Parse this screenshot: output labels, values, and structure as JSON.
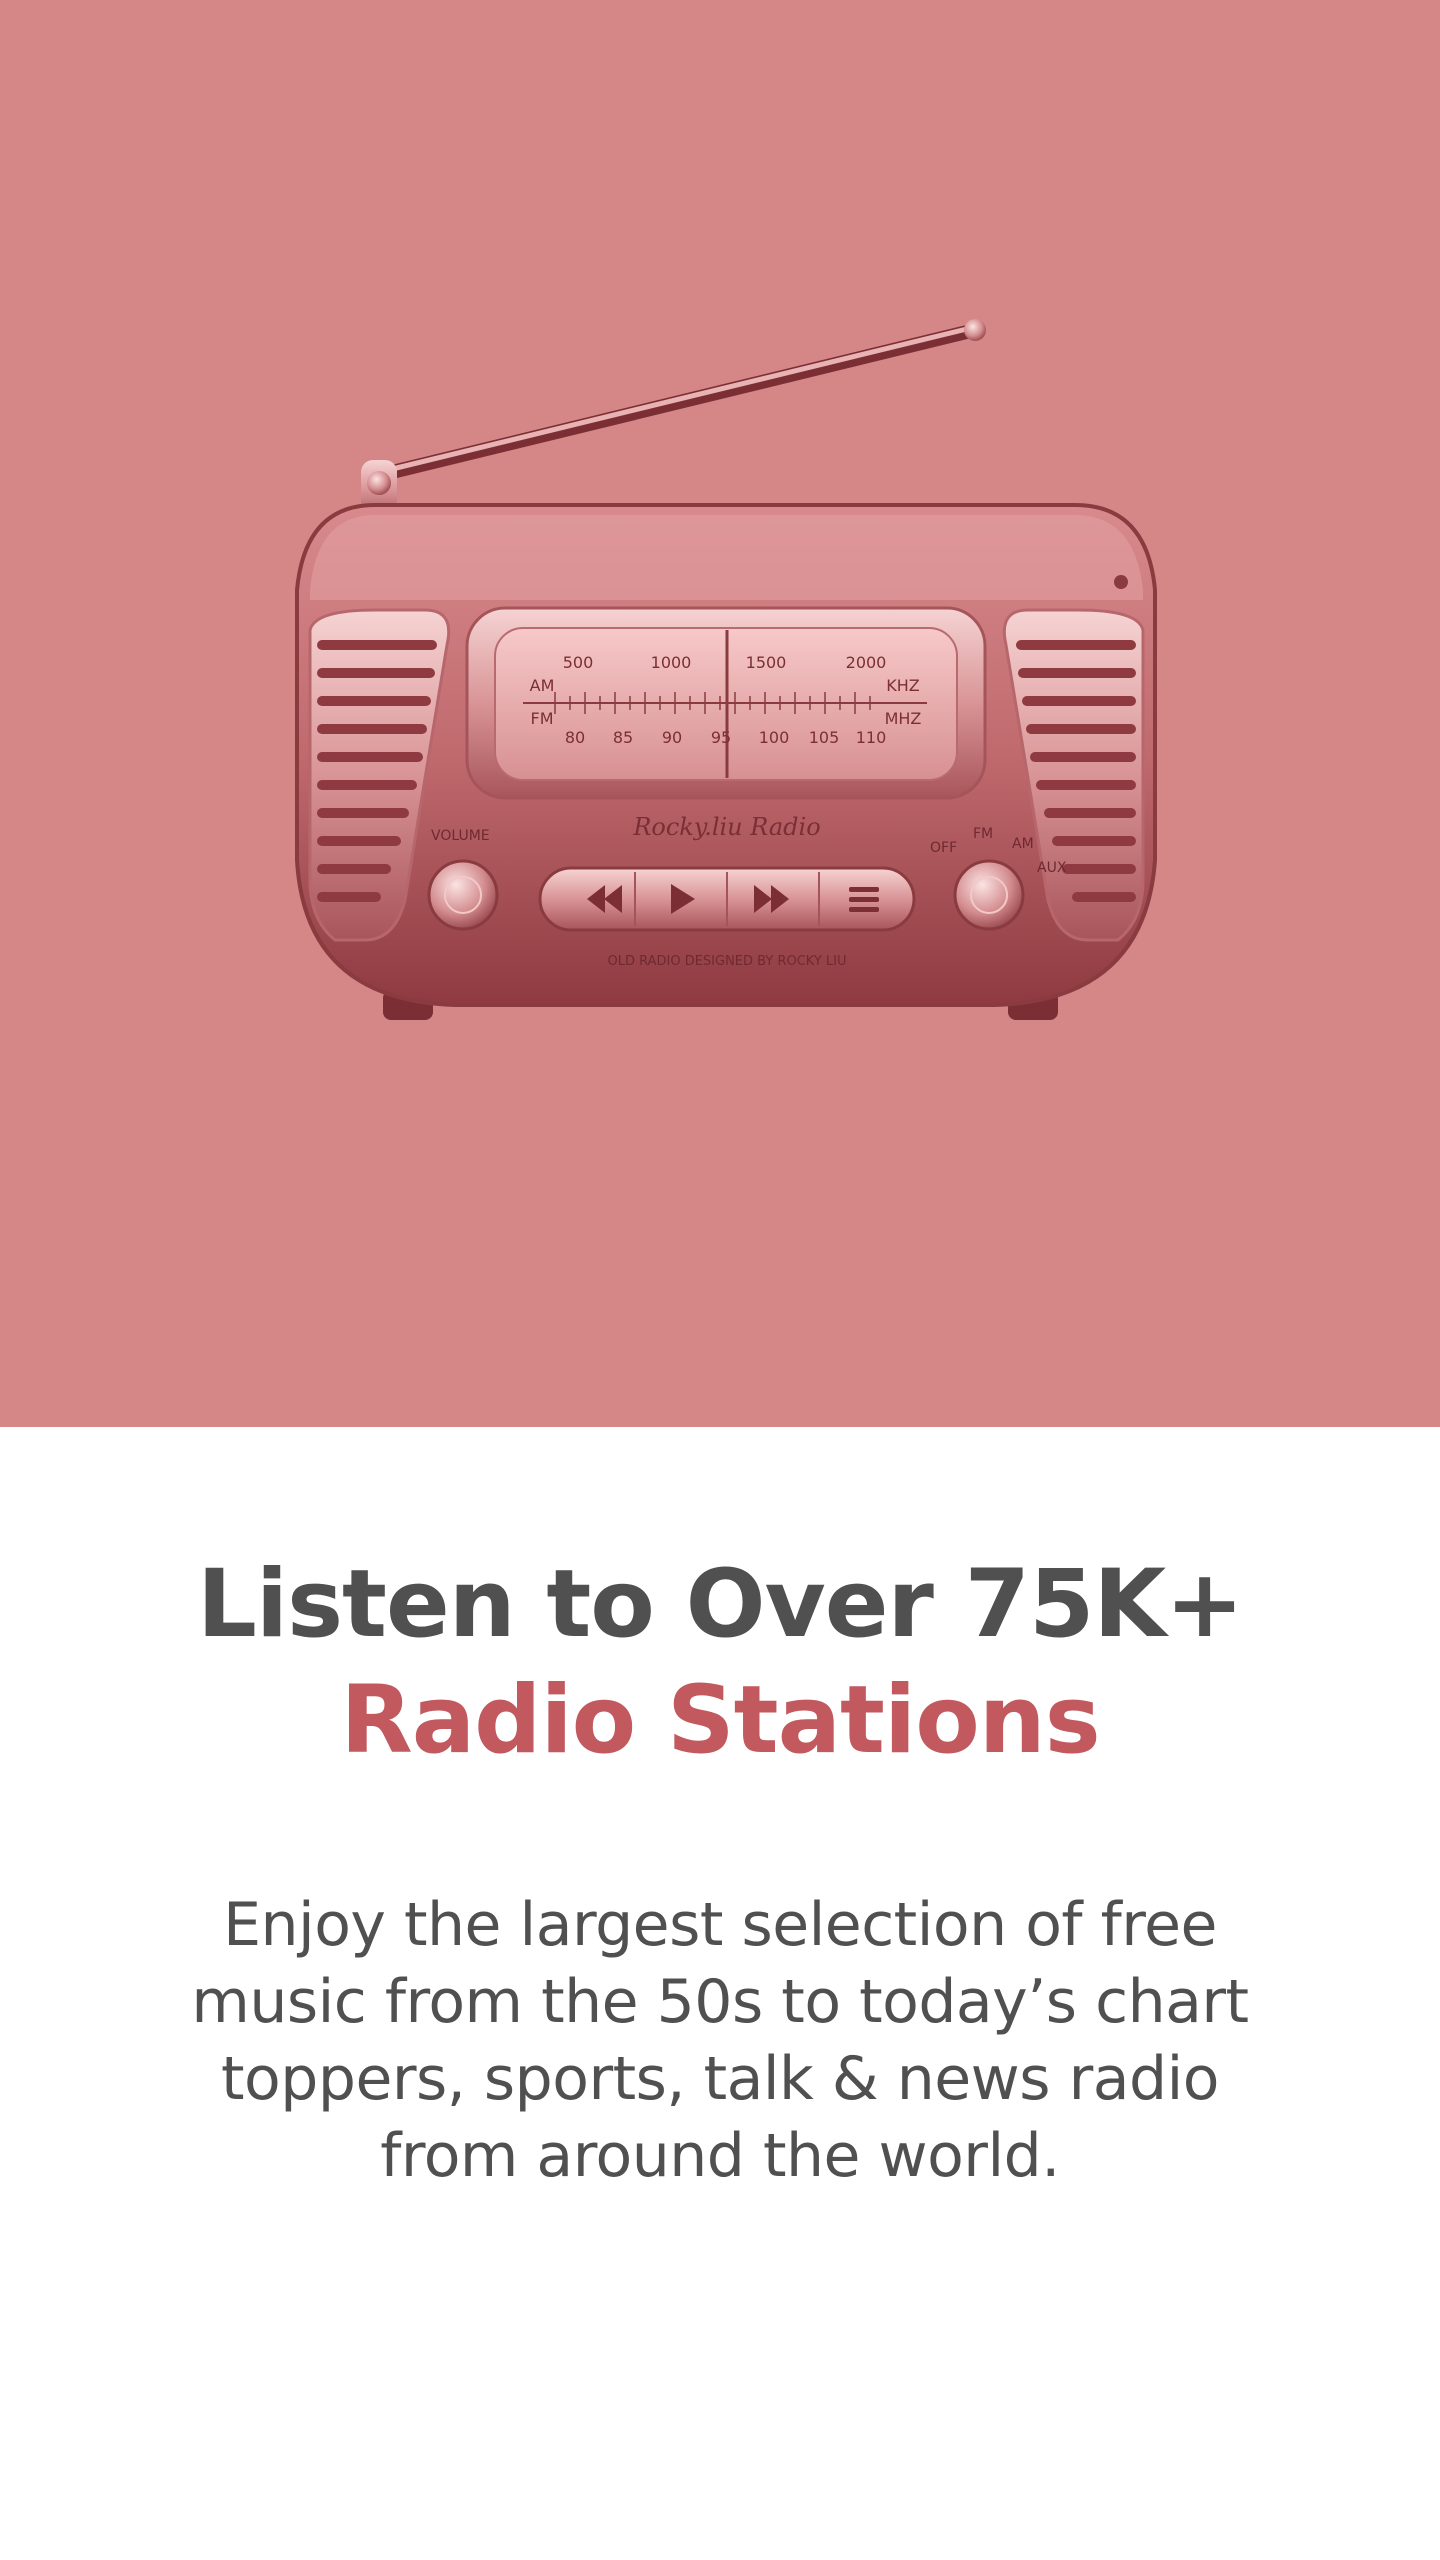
{
  "hero": {
    "background": "#d58686",
    "illustration": "vintage-radio",
    "radio": {
      "dial_top_values": [
        "500",
        "1000",
        "1500",
        "2000"
      ],
      "dial_bottom_values": [
        "80",
        "85",
        "90",
        "95",
        "100",
        "105",
        "110"
      ],
      "band_left_top": "AM",
      "band_left_bottom": "FM",
      "unit_top": "KHZ",
      "unit_bottom": "MHZ",
      "brand": "Rocky.liu Radio",
      "volume_label": "VOLUME",
      "mode_off": "OFF",
      "mode_fm": "FM",
      "mode_am": "AM",
      "mode_aux": "AUX",
      "credit": "OLD RADIO DESIGNED BY ROCKY LIU"
    }
  },
  "content": {
    "title_line1": "Listen to Over 75K+",
    "title_line2": "Radio Stations",
    "description": "Enjoy the largest selection of free music from the 50s to today’s chart toppers, sports, talk & news radio from around the world.",
    "accent_color": "#c2595e",
    "text_color": "#505050"
  }
}
